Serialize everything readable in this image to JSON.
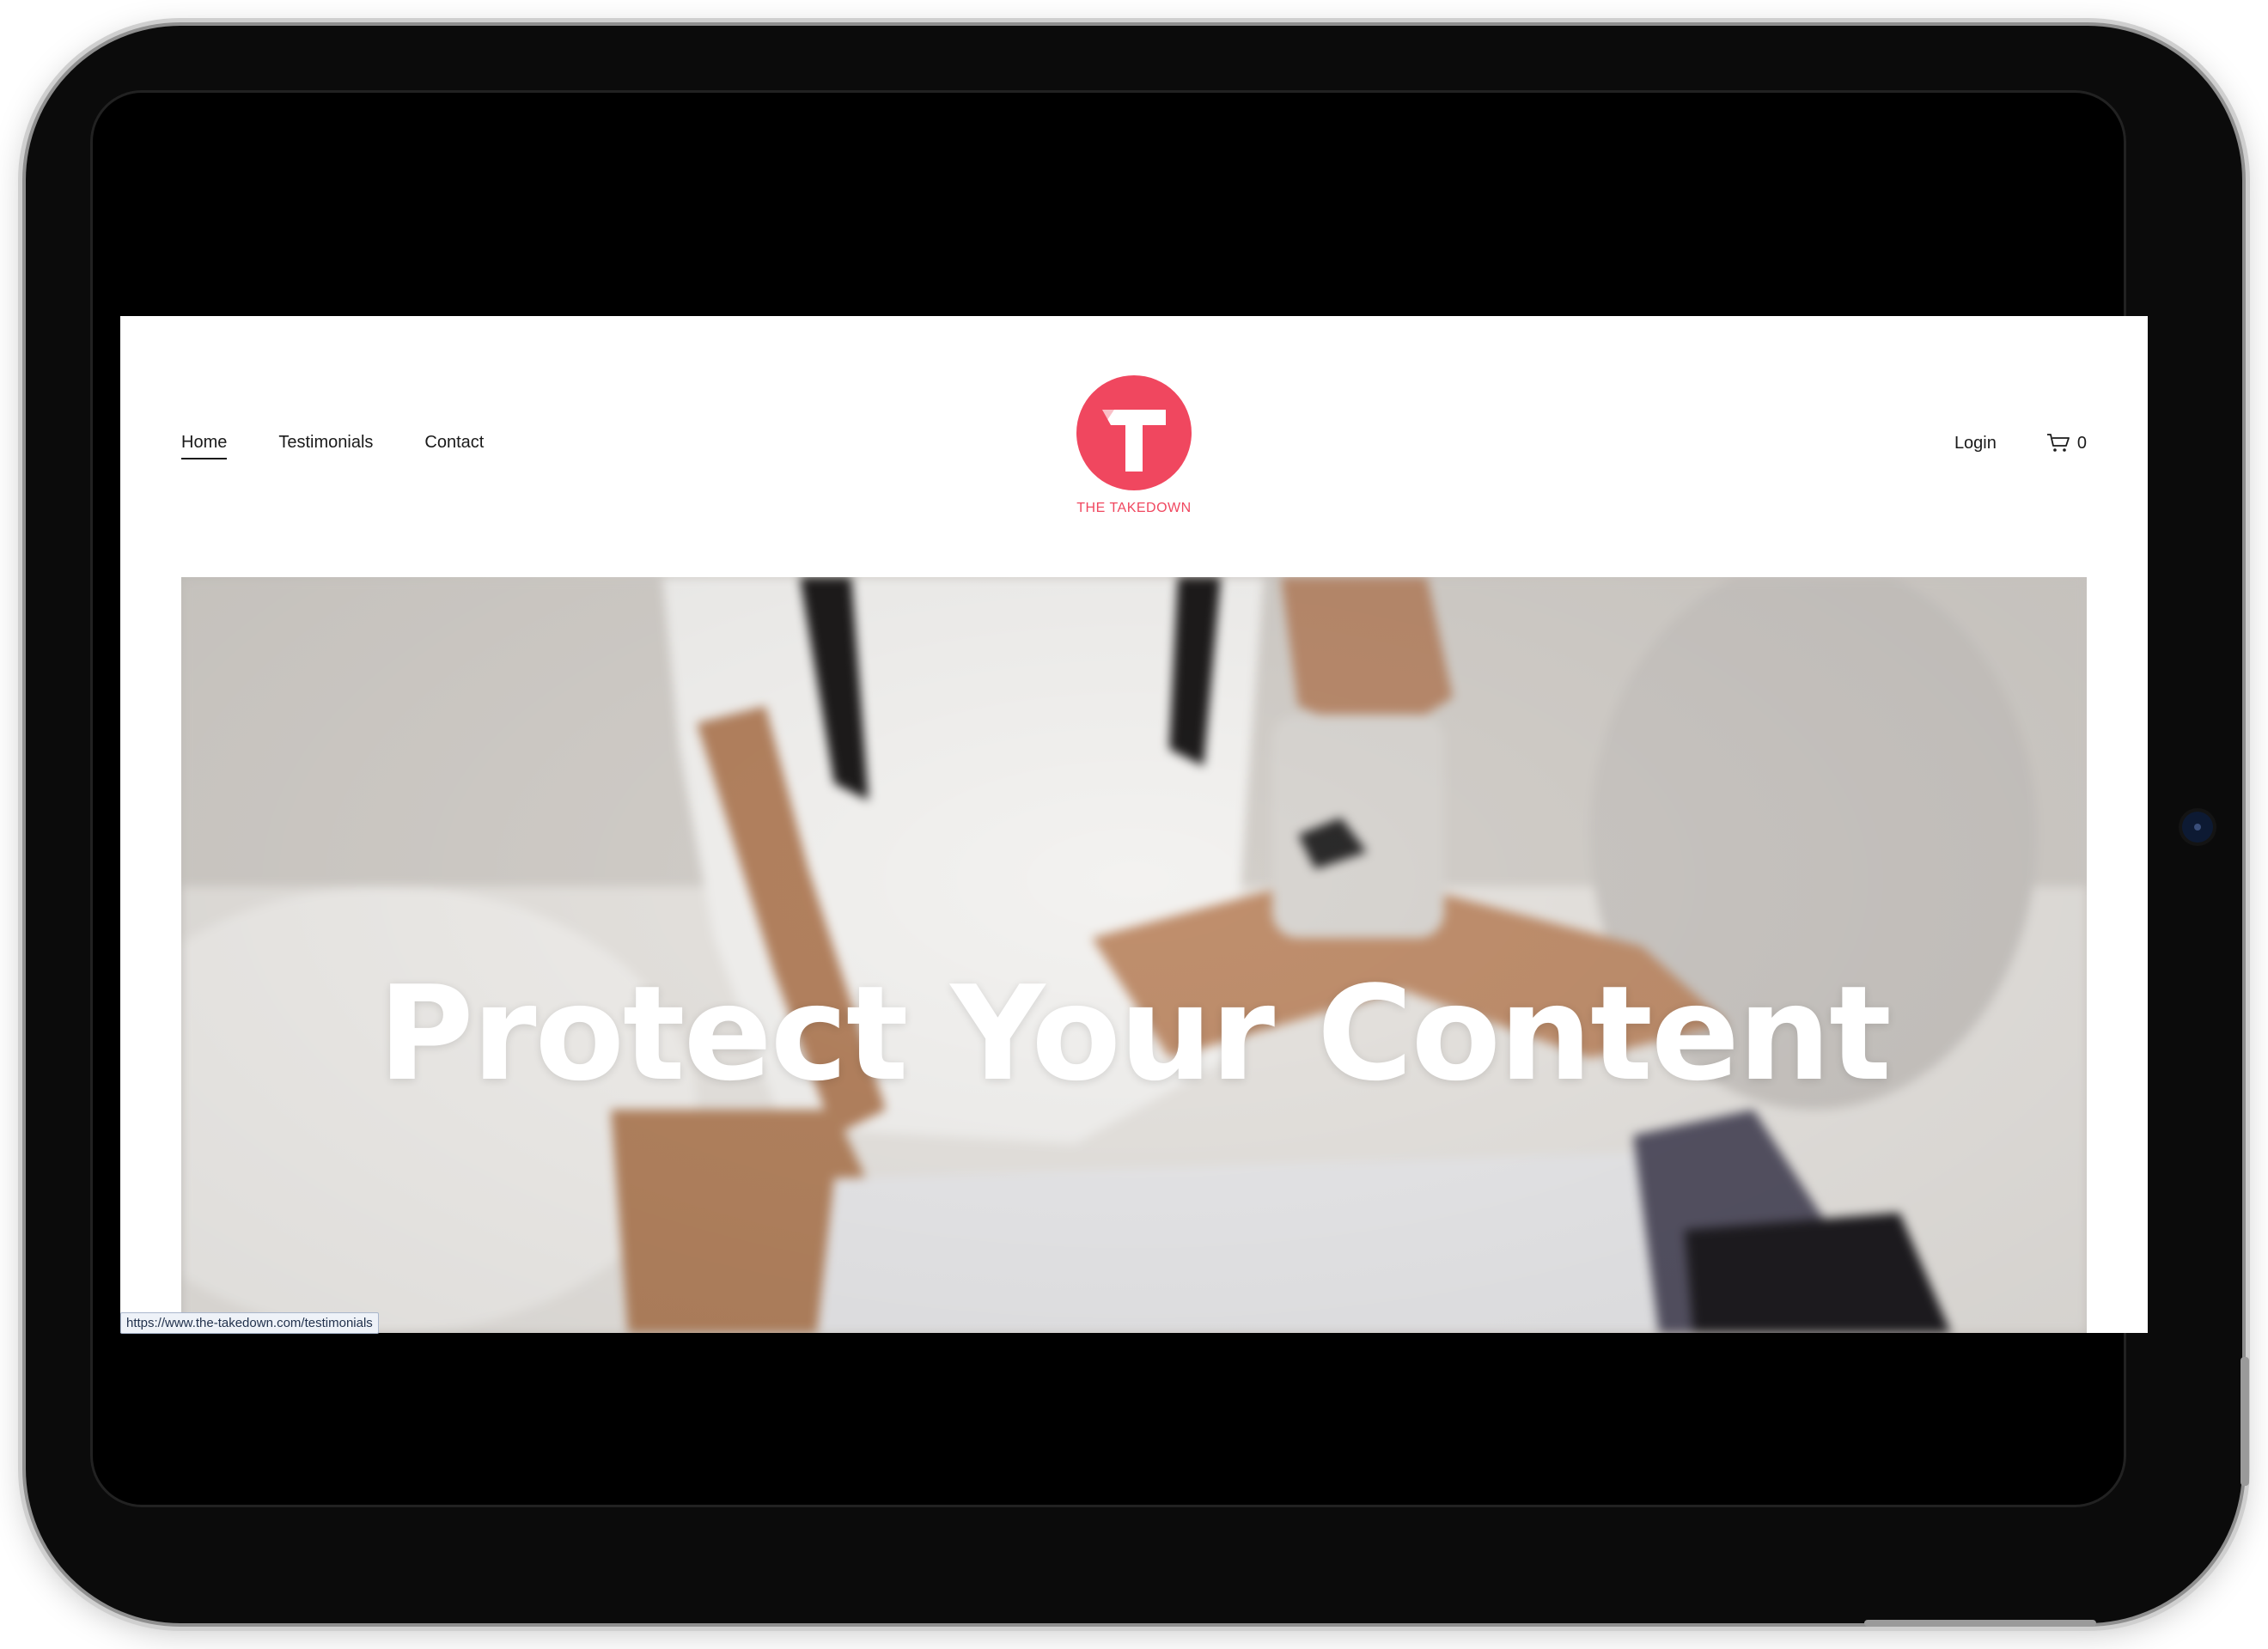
{
  "nav": {
    "items": [
      {
        "label": "Home",
        "active": true
      },
      {
        "label": "Testimonials",
        "active": false
      },
      {
        "label": "Contact",
        "active": false
      }
    ]
  },
  "brand": {
    "name": "THE TAKEDOWN",
    "accent_color": "#f0475f",
    "logo_icon": "t-logo-icon"
  },
  "account": {
    "login_label": "Login",
    "cart_icon": "cart-icon",
    "cart_count": "0"
  },
  "hero": {
    "title": "Protect Your Content"
  },
  "status_bar": {
    "url": "https://www.the-takedown.com/testimonials"
  }
}
